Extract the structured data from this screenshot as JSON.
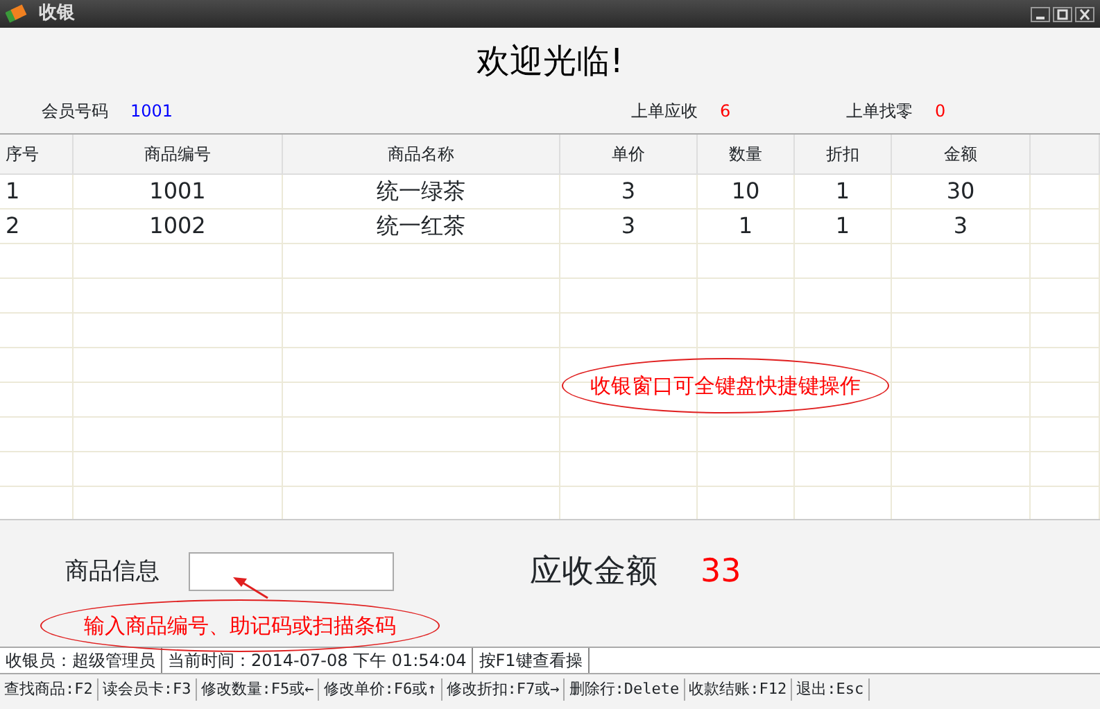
{
  "window": {
    "title": "收银"
  },
  "welcome": "欢迎光临!",
  "info": [
    {
      "label": "会员号码",
      "value": "1001",
      "kind": "member"
    },
    {
      "label": "上单应收",
      "value": "6",
      "kind": "amount"
    },
    {
      "label": "上单找零",
      "value": "0",
      "kind": "amount"
    }
  ],
  "table": {
    "columns": [
      "序号",
      "商品编号",
      "商品名称",
      "单价",
      "数量",
      "折扣",
      "金额"
    ],
    "rows": [
      [
        "1",
        "1001",
        "统一绿茶",
        "3",
        "10",
        "1",
        "30"
      ],
      [
        "2",
        "1002",
        "统一红茶",
        "3",
        "1",
        "1",
        "3"
      ]
    ]
  },
  "product_info": {
    "label": "商品信息"
  },
  "total": {
    "label": "应收金额",
    "value": "33"
  },
  "annotations": [
    {
      "text": "收银窗口可全键盘快捷键操作",
      "kind": "ellipse"
    },
    {
      "text": "输入商品编号、助记码或扫描条码",
      "kind": "ellipse-arrow"
    }
  ],
  "status_bar": [
    "收银员：超级管理员",
    "当前时间：2014-07-08 下午 01:54:04",
    "按F1键查看操"
  ],
  "shortcuts": [
    "查找商品:F2",
    "读会员卡:F3",
    "修改数量:F5或←",
    "修改单价:F6或↑",
    "修改折扣:F7或→",
    "删除行:Delete",
    "收款结账:F12",
    "退出:Esc"
  ]
}
